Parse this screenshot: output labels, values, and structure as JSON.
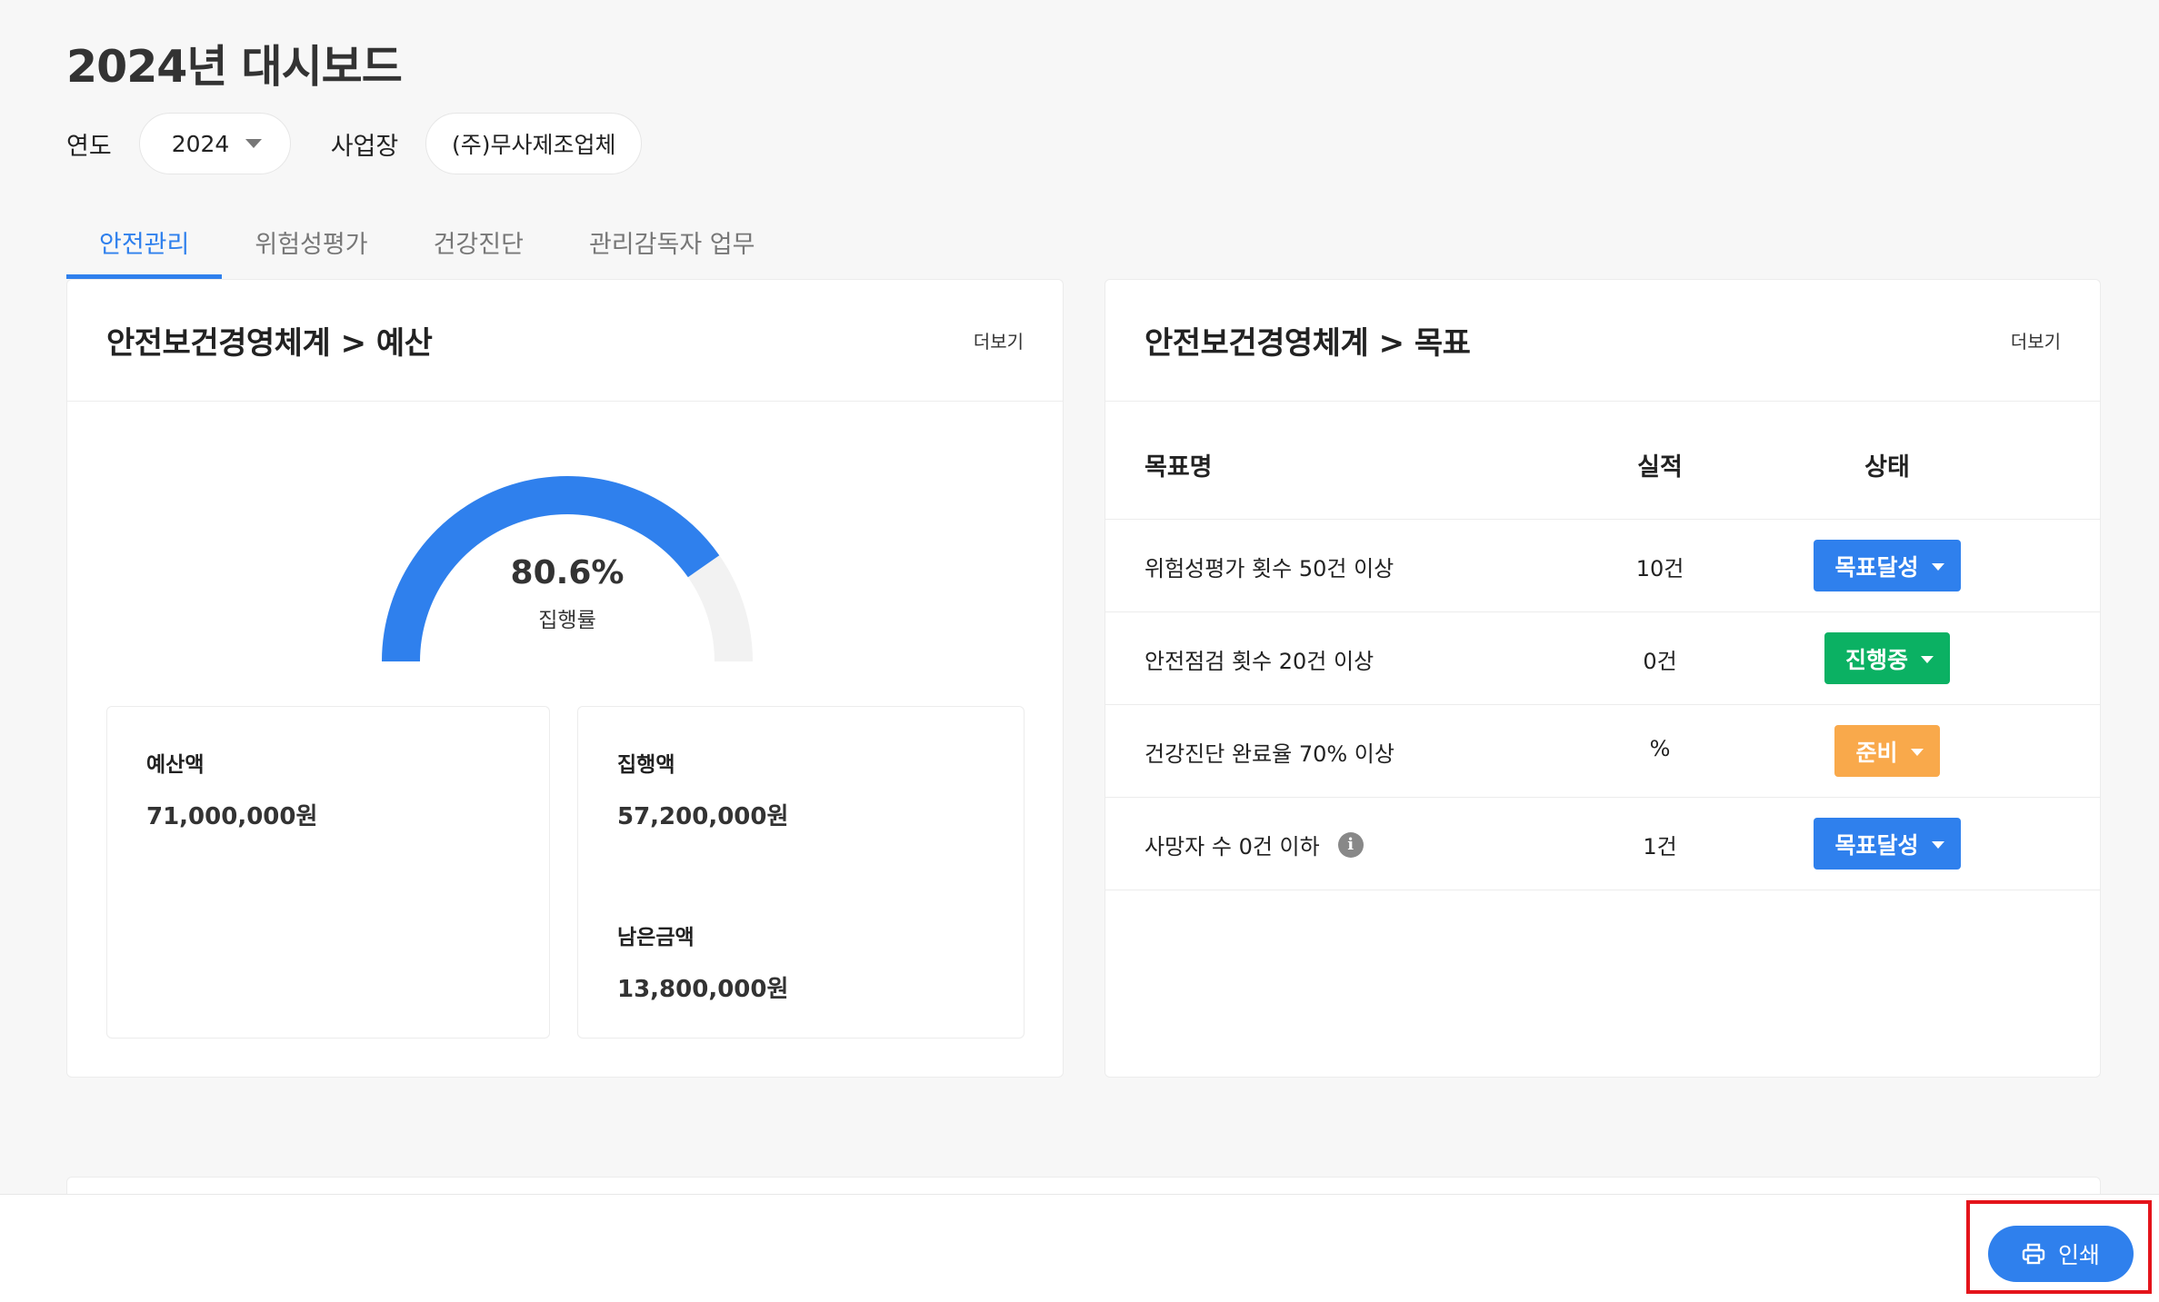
{
  "page": {
    "title": "2024년 대시보드"
  },
  "filters": {
    "year_label": "연도",
    "year_value": "2024",
    "site_label": "사업장",
    "site_value": "(주)무사제조업체"
  },
  "tabs": [
    {
      "label": "안전관리",
      "active": true
    },
    {
      "label": "위험성평가",
      "active": false
    },
    {
      "label": "건강진단",
      "active": false
    },
    {
      "label": "관리감독자 업무",
      "active": false
    }
  ],
  "budget_card": {
    "title": "안전보건경영체계 > 예산",
    "more": "더보기",
    "gauge": {
      "value_text": "80.6%",
      "fraction": 0.806,
      "label": "집행률",
      "fill_color": "#2f80ed",
      "track_color": "#f2f2f2"
    },
    "budget": {
      "label": "예산액",
      "value": "71,000,000원"
    },
    "spent": {
      "label": "집행액",
      "value": "57,200,000원"
    },
    "remaining": {
      "label": "남은금액",
      "value": "13,800,000원"
    }
  },
  "goal_card": {
    "title": "안전보건경영체계 > 목표",
    "more": "더보기",
    "columns": {
      "name": "목표명",
      "result": "실적",
      "status": "상태"
    },
    "rows": [
      {
        "name": "위험성평가 횟수 50건 이상",
        "result": "10건",
        "status": "목표달성",
        "color": "#2f80ed",
        "info": false
      },
      {
        "name": "안전점검 횟수 20건 이상",
        "result": "0건",
        "status": "진행중",
        "color": "#0bb163",
        "info": false
      },
      {
        "name": "건강진단 완료율 70% 이상",
        "result": "%",
        "status": "준비",
        "color": "#f9a94b",
        "info": false
      },
      {
        "name": "사망자 수 0건 이하",
        "result": "1건",
        "status": "목표달성",
        "color": "#2f80ed",
        "info": true
      }
    ]
  },
  "footer": {
    "print_label": "인쇄"
  },
  "icons": {
    "info": "i"
  }
}
